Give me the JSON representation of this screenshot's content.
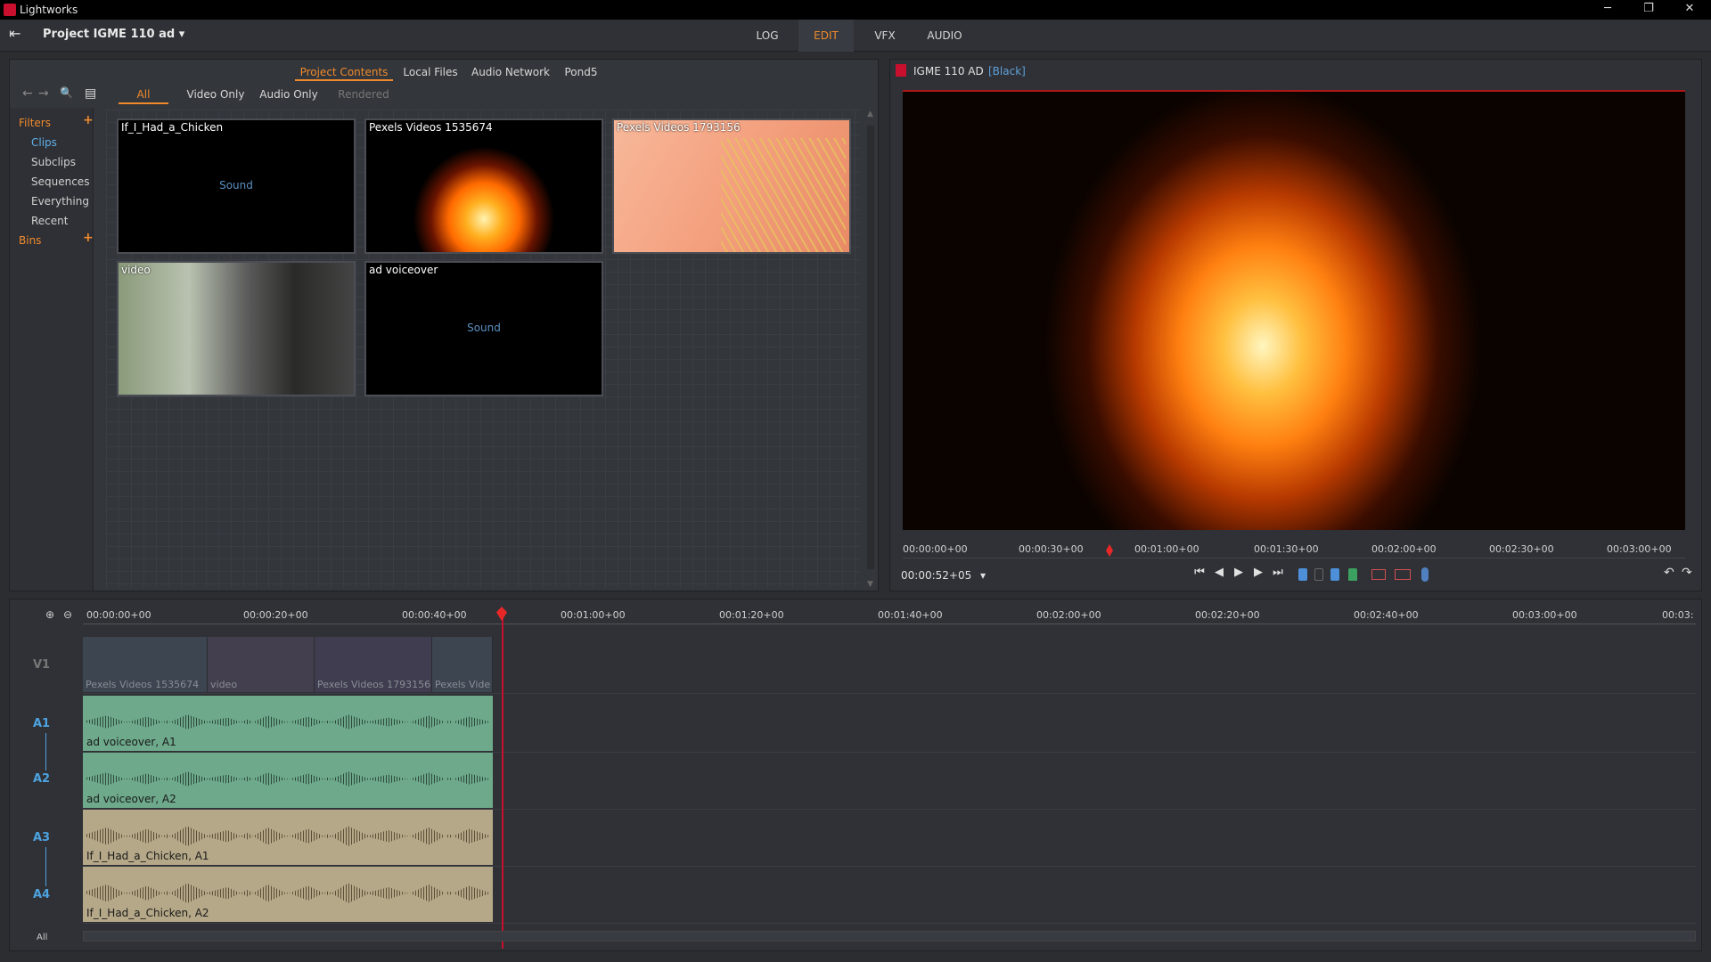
{
  "window": {
    "title": "Lightworks",
    "min": "─",
    "restore": "❐",
    "close": "✕"
  },
  "menubar": {
    "exit_icon": "⇤",
    "project": "Project IGME 110 ad",
    "project_caret": "▾",
    "tabs": [
      {
        "label": "LOG",
        "active": false
      },
      {
        "label": "EDIT",
        "active": true
      },
      {
        "label": "VFX",
        "active": false
      },
      {
        "label": "AUDIO",
        "active": false
      }
    ]
  },
  "browser": {
    "source_tabs": [
      "Project Contents",
      "Local Files",
      "Audio Network",
      "Pond5"
    ],
    "filter_tabs": [
      "All",
      "Video Only",
      "Audio Only",
      "Rendered"
    ],
    "nav_icons": {
      "back": "←",
      "forward": "→",
      "search": "🔍",
      "view": "▤"
    },
    "sidebar": {
      "filters_label": "Filters",
      "items": [
        "Clips",
        "Subclips",
        "Sequences",
        "Everything",
        "Recent"
      ],
      "bins_label": "Bins",
      "add": "+"
    },
    "clips": [
      {
        "name": "If_I_Had_a_Chicken",
        "kind": "Sound"
      },
      {
        "name": "Pexels Videos 1535674",
        "kind": "fire"
      },
      {
        "name": "Pexels Videos 1793156",
        "kind": "pasta"
      },
      {
        "name": "video",
        "kind": "coffee"
      },
      {
        "name": "ad voiceover",
        "kind": "Sound"
      }
    ],
    "sound_label": "Sound"
  },
  "viewer": {
    "title": "IGME 110 AD",
    "tag": "[Black]",
    "ruler": [
      "00:00:00+00",
      "00:00:30+00",
      "00:01:00+00",
      "00:01:30+00",
      "00:02:00+00",
      "00:02:30+00",
      "00:03:00+00"
    ],
    "timecode": "00:00:52+05",
    "tc_caret": "▾",
    "controls": [
      "⏮",
      "◀",
      "▶",
      "▶",
      "⏭"
    ]
  },
  "timeline": {
    "zoom_in": "⊕",
    "zoom_out": "⊖",
    "ruler": [
      "00:00:00+00",
      "00:00:20+00",
      "00:00:40+00",
      "00:01:00+00",
      "00:01:20+00",
      "00:01:40+00",
      "00:02:00+00",
      "00:02:20+00",
      "00:02:40+00",
      "00:03:00+00",
      "00:03:"
    ],
    "tracks": [
      "V1",
      "A1",
      "A2",
      "A3",
      "A4"
    ],
    "all_label": "All",
    "video_clips": [
      "Pexels Videos 1535674",
      "video",
      "Pexels Videos 1793156",
      "Pexels Vide"
    ],
    "audio_clips": [
      "ad voiceover, A1",
      "ad voiceover, A2",
      "If_I_Had_a_Chicken, A1",
      "If_I_Had_a_Chicken, A2"
    ]
  },
  "colors": {
    "accent": "#f08a2c",
    "track_label": "#4da3e0",
    "playhead": "#c8102e",
    "audio_green": "#6da98a",
    "audio_tan": "#b5a888"
  }
}
